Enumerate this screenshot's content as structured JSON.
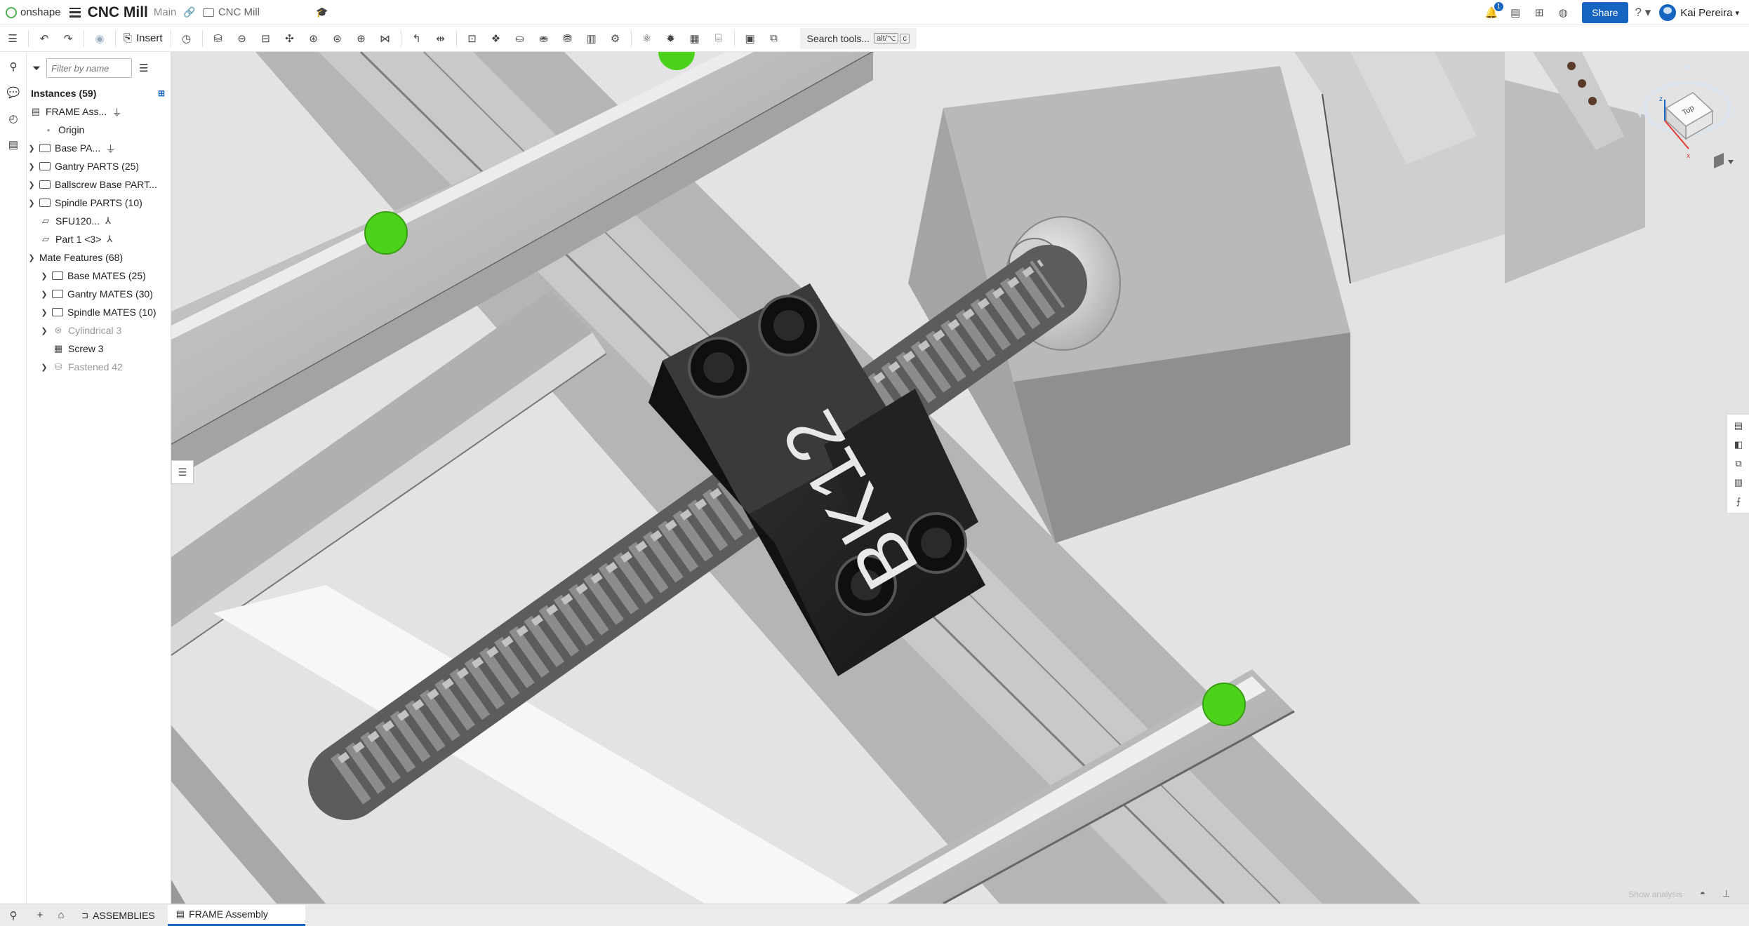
{
  "app": {
    "logo_text": "onshape"
  },
  "header": {
    "title": "CNC Mill",
    "branch": "Main",
    "folder": "CNC Mill",
    "notification_count": "1",
    "share_label": "Share",
    "user_name": "Kai Pereira",
    "help_icon": "?"
  },
  "toolbar": {
    "insert_label": "Insert",
    "search_label": "Search tools...",
    "search_shortcut_1": "alt/⌥",
    "search_shortcut_2": "c"
  },
  "panel": {
    "filter_placeholder": "Filter by name",
    "instances_heading": "Instances (59)",
    "instances": [
      {
        "label": "FRAME Ass...",
        "kind": "assembly"
      },
      {
        "label": "Origin",
        "kind": "origin"
      },
      {
        "label": "Base PA...",
        "kind": "folder"
      },
      {
        "label": "Gantry PARTS (25)",
        "kind": "folder"
      },
      {
        "label": "Ballscrew Base PART...",
        "kind": "folder"
      },
      {
        "label": "Spindle PARTS (10)",
        "kind": "folder"
      },
      {
        "label": "SFU120...",
        "kind": "part"
      },
      {
        "label": "Part 1 <3>",
        "kind": "part"
      }
    ],
    "mates_heading": "Mate Features (68)",
    "mates": [
      {
        "label": "Base MATES (25)",
        "kind": "folder"
      },
      {
        "label": "Gantry MATES (30)",
        "kind": "folder"
      },
      {
        "label": "Spindle MATES (10)",
        "kind": "folder"
      },
      {
        "label": "Cylindrical 3",
        "kind": "mate"
      },
      {
        "label": "Screw 3",
        "kind": "mate"
      },
      {
        "label": "Fastened 42",
        "kind": "mate"
      }
    ]
  },
  "viewport": {
    "block_label": "BK12",
    "view_cube_label": "Top",
    "show_analysis": "Show analysis"
  },
  "tabs": {
    "assemblies_label": "ASSEMBLIES",
    "active_tab_label": "FRAME Assembly"
  },
  "colors": {
    "accent": "#1565c0",
    "mate_marker": "#4cd21a",
    "block": "#1d1d1d"
  }
}
